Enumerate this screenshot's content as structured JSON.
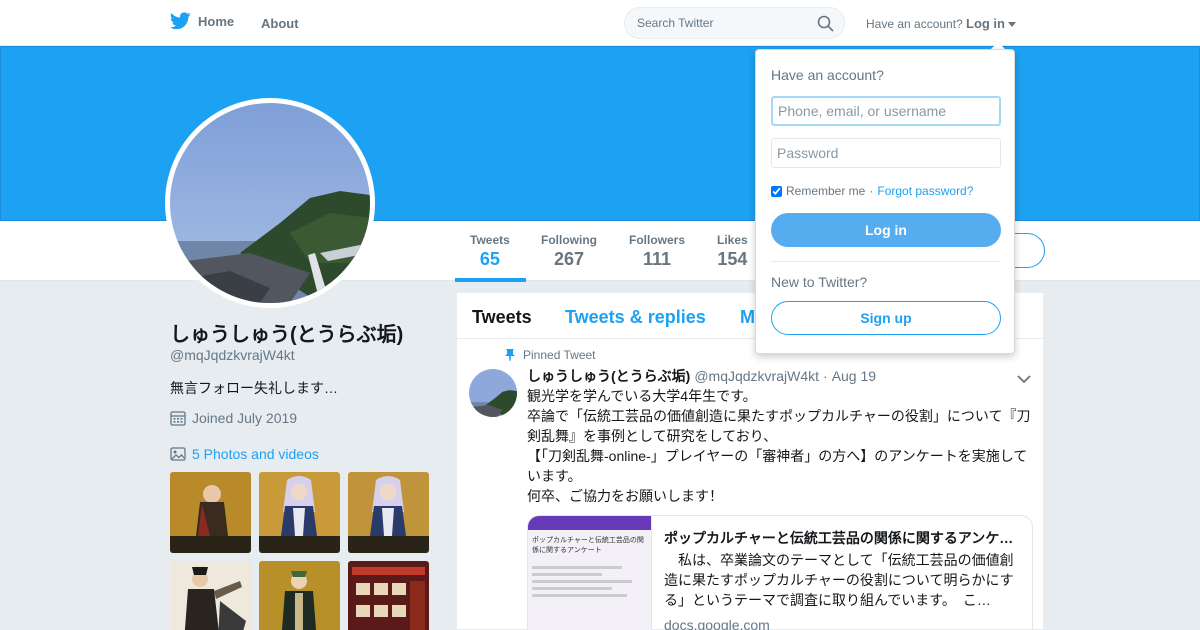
{
  "nav": {
    "home_label": "Home",
    "about_label": "About",
    "search_placeholder": "Search Twitter",
    "have_account": "Have an account?",
    "login_label": "Log in"
  },
  "stats": [
    {
      "label": "Tweets",
      "value": "65"
    },
    {
      "label": "Following",
      "value": "267"
    },
    {
      "label": "Followers",
      "value": "111"
    },
    {
      "label": "Likes",
      "value": "154"
    }
  ],
  "profile": {
    "name": "しゅうしゅう(とうらぶ垢)",
    "handle": "@mqJqdzkvrajW4kt",
    "bio": "無言フォロー失礼します…",
    "joined": "Joined July 2019",
    "photos_link": "5 Photos and videos"
  },
  "timeline": {
    "tabs": [
      "Tweets",
      "Tweets & replies",
      "M"
    ],
    "pinned_label": "Pinned Tweet",
    "tweet": {
      "name": "しゅうしゅう(とうらぶ垢)",
      "handle": "@mqJqdzkvrajW4kt",
      "separator": "·",
      "date": "Aug 19",
      "lines": [
        "観光学を学んでいる大学4年生です。",
        "卒論で「伝統工芸品の価値創造に果たすポップカルチャーの役割」について『刀剣乱舞』を事例として研究をしており、",
        "【「刀剣乱舞-online-」プレイヤーの「審神者」の方へ】のアンケートを実施しています。",
        "何卒、ご協力をお願いします！"
      ],
      "card": {
        "title": "ポップカルチャーと伝統工芸品の関係に関するアンケ…",
        "description": "　私は、卒業論文のテーマとして「伝統工芸品の価値創造に果たすポップカルチャーの役割について明らかにする」というテーマで調査に取り組んでいます。　こ…",
        "domain": "docs.google.com",
        "image_text": [
          "ポップカルチャーと伝統工芸品の関",
          "係に関するアンケート"
        ]
      }
    }
  },
  "login_dropdown": {
    "title": "Have an account?",
    "username_placeholder": "Phone, email, or username",
    "password_placeholder": "Password",
    "remember_me": "Remember me",
    "separator": "·",
    "forgot_password": "Forgot password?",
    "login_button": "Log in",
    "new_to_twitter": "New to Twitter?",
    "signup_button": "Sign up"
  },
  "colors": {
    "accent": "#1da1f2",
    "banner": "#1da1f2",
    "login_button": "#55acee",
    "background": "#e6ecf0"
  }
}
